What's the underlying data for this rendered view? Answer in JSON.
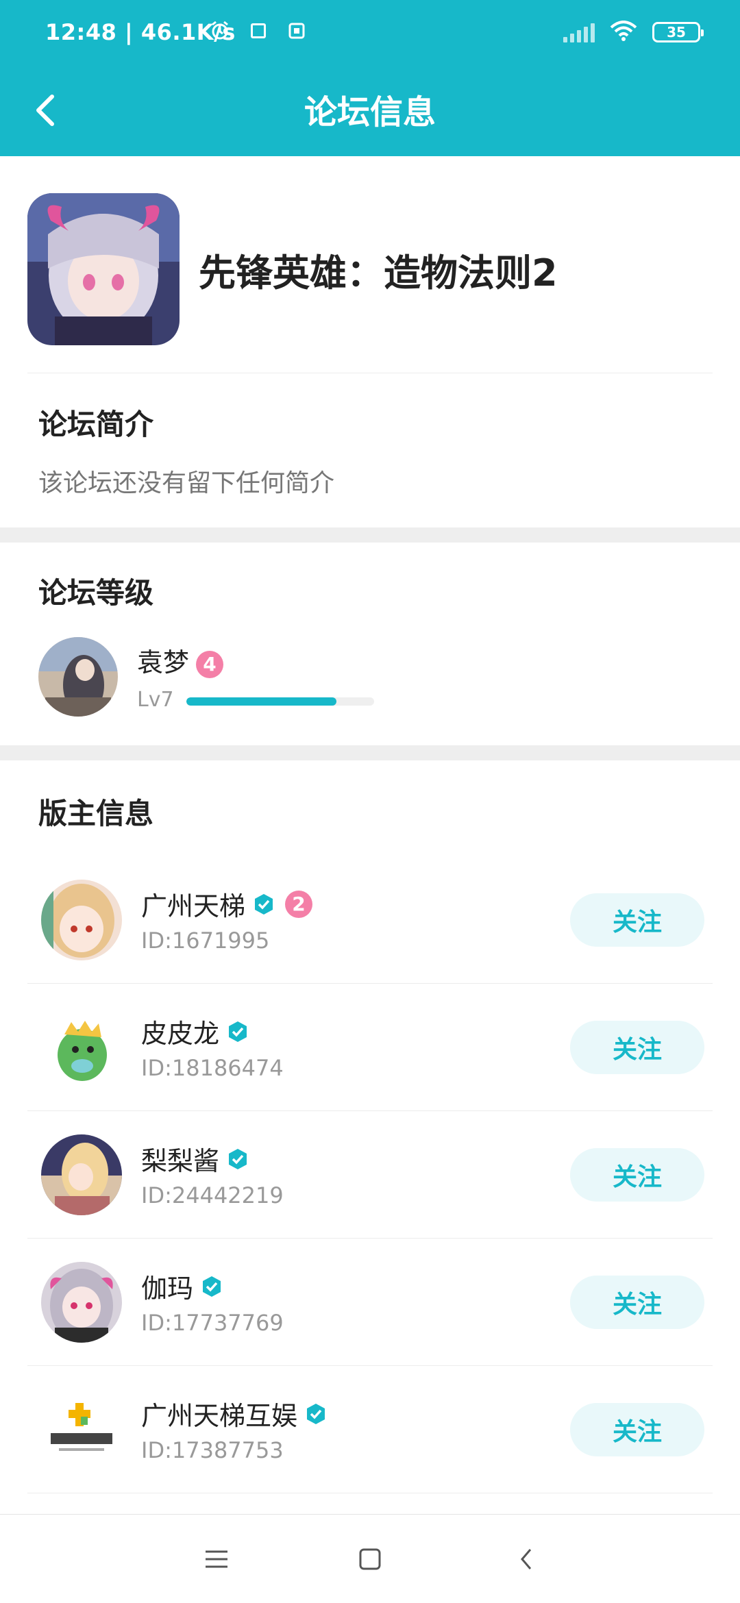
{
  "status_bar": {
    "time": "12:48 | 46.1K/s",
    "battery": "35",
    "icons": [
      "alarm-icon",
      "square-icon",
      "sim-icon",
      "signal-icon",
      "wifi-icon",
      "battery-icon"
    ]
  },
  "header": {
    "title": "论坛信息",
    "back_icon": "chevron-left-icon"
  },
  "forum": {
    "name": "先锋英雄：造物法则2",
    "icon": "game-avatar"
  },
  "intro": {
    "title": "论坛简介",
    "text": "该论坛还没有留下任何简介"
  },
  "level": {
    "title": "论坛等级",
    "user_name": "袁梦",
    "badge": "4",
    "lv_label": "Lv7",
    "progress": 0.8
  },
  "moderators": {
    "title": "版主信息",
    "follow_label": "关注",
    "items": [
      {
        "name": "广州天梯",
        "id": "ID:1671995",
        "badge": "2",
        "verified": true
      },
      {
        "name": "皮皮龙",
        "id": "ID:18186474",
        "verified": true
      },
      {
        "name": "梨梨酱",
        "id": "ID:24442219",
        "verified": true
      },
      {
        "name": "伽玛",
        "id": "ID:17737769",
        "verified": true
      },
      {
        "name": "广州天梯互娱",
        "id": "ID:17387753",
        "verified": true
      }
    ]
  },
  "colors": {
    "accent": "#17b8c9",
    "badge_pink": "#f47fa7",
    "follow_bg": "#e9f8fa"
  }
}
